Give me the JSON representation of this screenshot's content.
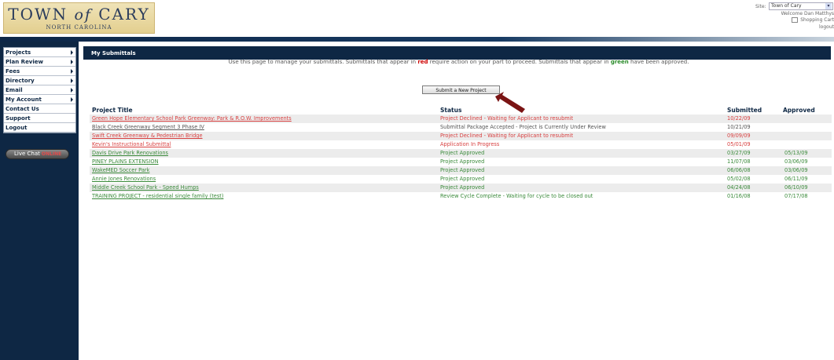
{
  "header": {
    "logo_line1_a": "TOWN",
    "logo_line1_of": "of",
    "logo_line1_b": "CARY",
    "logo_line2": "NORTH CAROLINA",
    "site_label": "Site:",
    "site_value": "Town of Cary",
    "welcome": "Welcome Dan Matthys",
    "cart": "Shopping Cart",
    "logout": "logout"
  },
  "nav": {
    "items": [
      {
        "label": "Projects",
        "arrow": true
      },
      {
        "label": "Plan Review",
        "arrow": true
      },
      {
        "label": "Fees",
        "arrow": true
      },
      {
        "label": "Directory",
        "arrow": true
      },
      {
        "label": "Email",
        "arrow": true
      },
      {
        "label": "My Account",
        "arrow": true
      },
      {
        "label": "Contact Us",
        "arrow": false
      },
      {
        "label": "Support",
        "arrow": false
      },
      {
        "label": "Logout",
        "arrow": false
      }
    ],
    "livechat": "Live Chat",
    "livechat_status": "ONLINE"
  },
  "main": {
    "title": "My Submittals",
    "intro_a": "Use this page to manage your submittals. Submittals that appear in",
    "intro_red": "red",
    "intro_b": "require action on your part to proceed. Submittals that appear in",
    "intro_green": "green",
    "intro_c": "have been approved.",
    "submit_button": "Submit a New Project",
    "columns": {
      "title": "Project Title",
      "status": "Status",
      "submitted": "Submitted",
      "approved": "Approved"
    },
    "rows": [
      {
        "title": "Green Hope Elementary School Park Greenway: Park & R.O.W. Improvements",
        "status": "Project Declined - Waiting for Applicant to resubmit",
        "submitted": "10/22/09",
        "approved": "",
        "color": "red"
      },
      {
        "title": "Black Creek Greenway Segment 3 Phase IV",
        "status": "Submittal Package Accepted - Project is Currently Under Review",
        "submitted": "10/21/09",
        "approved": "",
        "color": "gray"
      },
      {
        "title": "Swift Creek Greenway & Pedestrian Bridge",
        "status": "Project Declined - Waiting for Applicant to resubmit",
        "submitted": "09/09/09",
        "approved": "",
        "color": "red"
      },
      {
        "title": "Kevin's Instructional Submittal",
        "status": "Application In Progress",
        "submitted": "05/01/09",
        "approved": "",
        "color": "red"
      },
      {
        "title": "Davis Drive Park Renovations",
        "status": "Project Approved",
        "submitted": "03/27/09",
        "approved": "05/13/09",
        "color": "green"
      },
      {
        "title": "PINEY PLAINS EXTENSION",
        "status": "Project Approved",
        "submitted": "11/07/08",
        "approved": "03/06/09",
        "color": "green"
      },
      {
        "title": "WakeMED Soccer Park",
        "status": "Project Approved",
        "submitted": "06/06/08",
        "approved": "03/06/09",
        "color": "green"
      },
      {
        "title": "Annie Jones Renovations",
        "status": "Project Approved",
        "submitted": "05/02/08",
        "approved": "06/11/09",
        "color": "green"
      },
      {
        "title": "Middle Creek School Park - Speed Humps",
        "status": "Project Approved",
        "submitted": "04/24/08",
        "approved": "06/10/09",
        "color": "green"
      },
      {
        "title": "TRAINING PROJECT - residential single family (test)",
        "status": "Review Cycle Complete - Waiting for cycle to be closed out",
        "submitted": "01/16/08",
        "approved": "07/17/08",
        "color": "green"
      }
    ]
  },
  "colors": {
    "navy": "#0e2744",
    "red": "#d84040",
    "green": "#3a8a3a",
    "gray": "#555555"
  }
}
